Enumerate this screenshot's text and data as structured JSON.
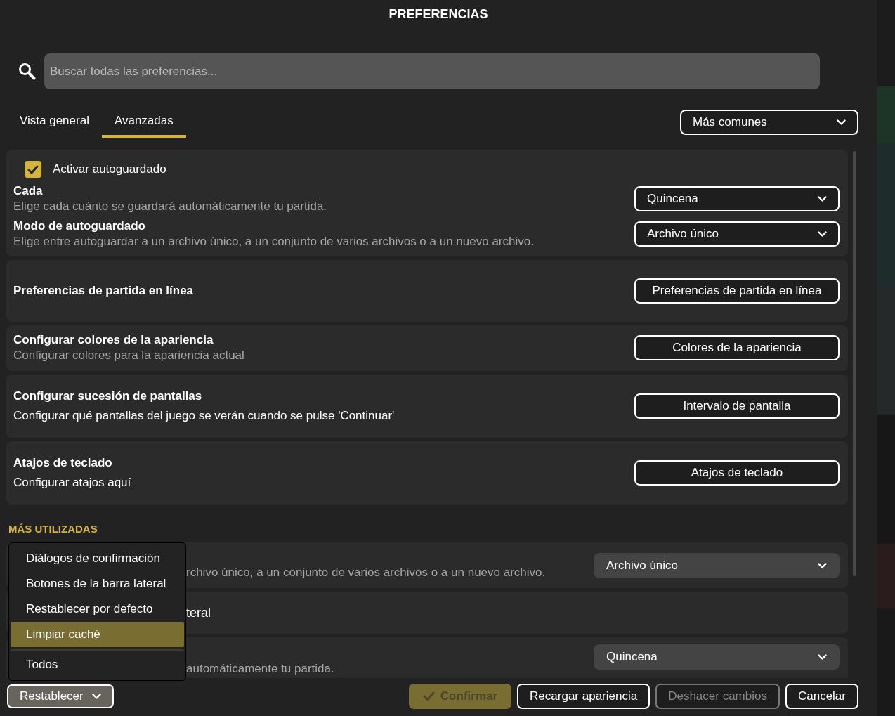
{
  "title": "PREFERENCIAS",
  "search": {
    "placeholder": "Buscar todas las preferencias..."
  },
  "tabs": [
    {
      "label": "Vista general",
      "selected": false
    },
    {
      "label": "Avanzadas",
      "selected": true
    }
  ],
  "filter": {
    "value": "Más comunes"
  },
  "cards": [
    {
      "checkbox": {
        "label": "Activar autoguardado",
        "checked": true
      },
      "compact": true,
      "rows": [
        {
          "title": "Cada",
          "description": "Elige cada cuánto se guardará automáticamente tu partida.",
          "muted": true,
          "control": {
            "kind": "select",
            "value": "Quincena"
          }
        },
        {
          "title": "Modo de autoguardado",
          "description": "Elige entre autoguardar a un archivo único, a un conjunto de varios archivos o a un nuevo archivo.",
          "muted": true,
          "control": {
            "kind": "select",
            "value": "Archivo único"
          }
        }
      ]
    },
    {
      "compact": false,
      "rows": [
        {
          "title": "Preferencias de partida en línea",
          "control": {
            "kind": "button",
            "value": "Preferencias de partida en línea"
          }
        }
      ]
    },
    {
      "compact": true,
      "rows": [
        {
          "title": "Configurar colores de la apariencia",
          "description": "Configurar colores para la apariencia actual",
          "muted": true,
          "control": {
            "kind": "button",
            "value": "Colores de la apariencia"
          }
        }
      ]
    },
    {
      "compact": false,
      "rows": [
        {
          "title": "Configurar sucesión de pantallas",
          "description": "Configurar qué pantallas del juego se verán cuando se pulse 'Continuar'",
          "muted": false,
          "control": {
            "kind": "button",
            "value": "Intervalo de pantalla"
          }
        }
      ]
    },
    {
      "compact": false,
      "rows": [
        {
          "title": "Atajos de teclado",
          "description": "Configurar atajos aquí",
          "muted": false,
          "control": {
            "kind": "button",
            "value": "Atajos de teclado"
          }
        }
      ]
    }
  ],
  "most_used": {
    "heading": "MÁS UTILIZADAS",
    "cards": [
      {
        "description": "rchivo único, a un conjunto de varios archivos o a un nuevo archivo.",
        "control": {
          "kind": "filled-select",
          "value": "Archivo único"
        }
      },
      {
        "label": "teral"
      },
      {
        "description": "automáticamente tu partida.",
        "control": {
          "kind": "filled-select",
          "value": "Quincena"
        }
      }
    ]
  },
  "menu": {
    "items": [
      {
        "label": "Diálogos de confirmación",
        "selected": false,
        "divider_before": false
      },
      {
        "label": "Botones de la barra lateral",
        "selected": false,
        "divider_before": false
      },
      {
        "label": "Restablecer por defecto",
        "selected": false,
        "divider_before": false
      },
      {
        "label": "Limpiar caché",
        "selected": true,
        "divider_before": false
      },
      {
        "label": "Todos",
        "selected": false,
        "divider_before": true
      }
    ]
  },
  "footer": {
    "reset": {
      "label": "Restablecer",
      "expanded": true
    },
    "buttons": [
      {
        "label": "Confirmar",
        "kind": "confirm",
        "disabled": true
      },
      {
        "label": "Recargar apariencia",
        "kind": "outline",
        "disabled": false
      },
      {
        "label": "Deshacer cambios",
        "kind": "outline",
        "disabled": true
      },
      {
        "label": "Cancelar",
        "kind": "outline",
        "disabled": false
      }
    ]
  }
}
